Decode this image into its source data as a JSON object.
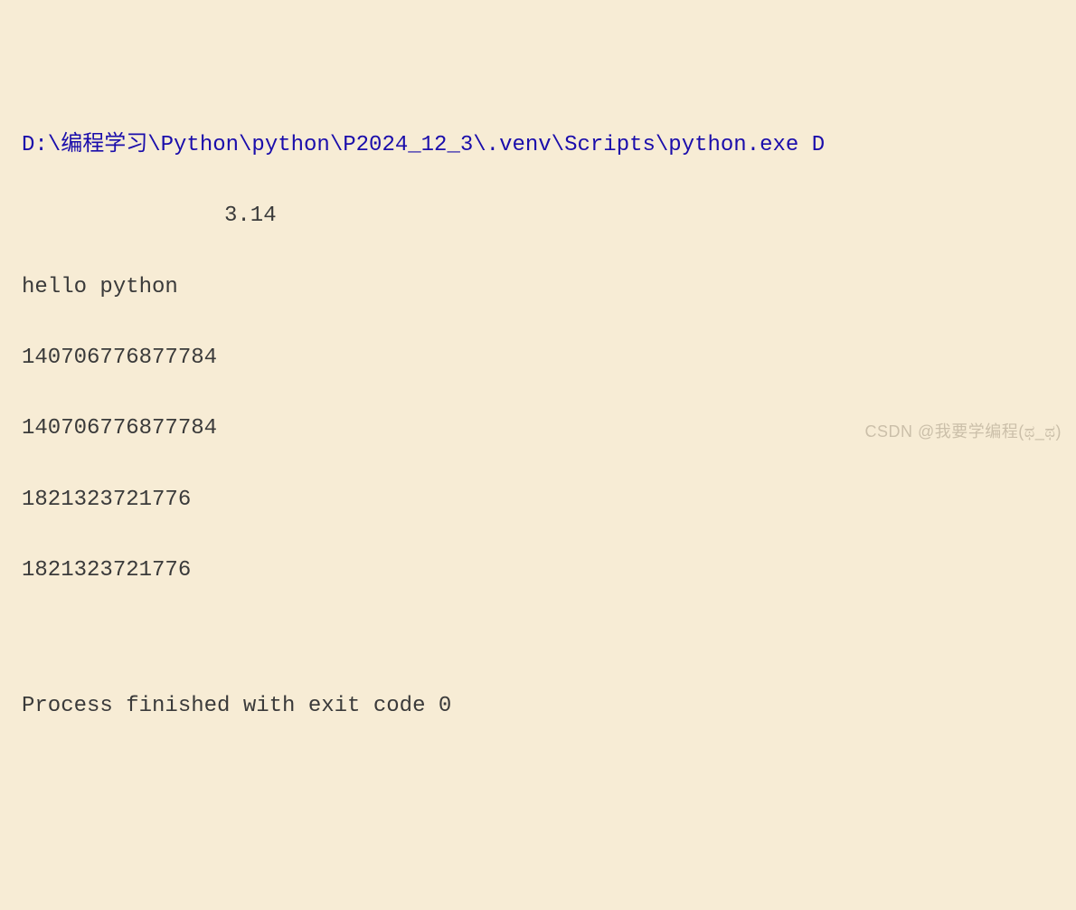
{
  "console": {
    "command": "D:\\编程学习\\Python\\python\\P2024_12_3\\.venv\\Scripts\\python.exe D",
    "output": {
      "line1": "3.14",
      "line2": "hello python",
      "line3": "140706776877784",
      "line4": "140706776877784",
      "line5": "1821323721776",
      "line6": "1821323721776"
    },
    "exit_message": "Process finished with exit code 0"
  },
  "watermark": "CSDN @我要学编程(ಥ_ಥ)"
}
